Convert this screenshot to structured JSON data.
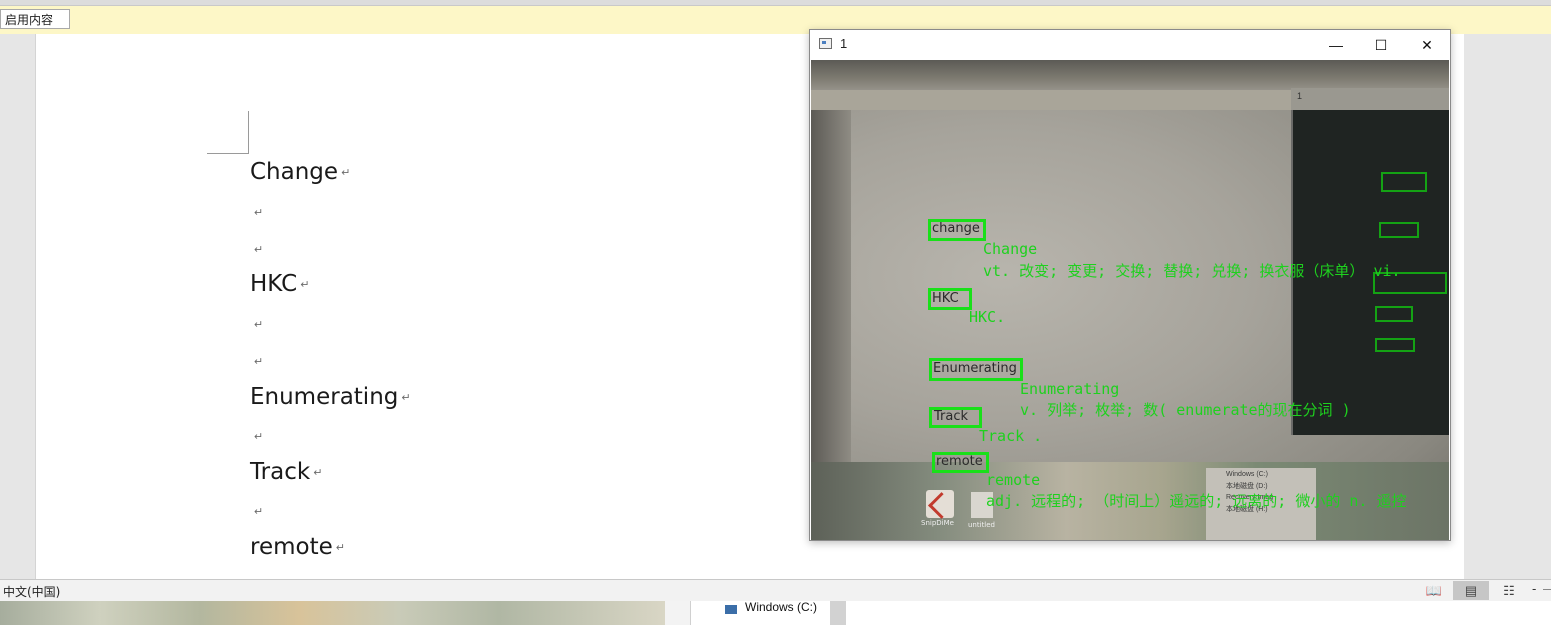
{
  "message_bar": {
    "enable_button": "启用内容"
  },
  "document": {
    "paragraphs": [
      {
        "text": "Change"
      },
      {
        "text": "HKC"
      },
      {
        "text": "Enumerating"
      },
      {
        "text": "Track"
      },
      {
        "text": "remote"
      }
    ],
    "paragraph_mark": "↵"
  },
  "status_bar": {
    "language": "中文(中国)",
    "zoom_minus": "-"
  },
  "bottom_strip": {
    "drive_label": "Windows (C:)"
  },
  "camera_window": {
    "title": "1",
    "controls": {
      "minimize": "—",
      "maximize": "☐",
      "close": "✕"
    },
    "detections": [
      {
        "word": "change",
        "translation": [
          "Change",
          "vt. 改变; 变更; 交换; 替换; 兑换; 换衣服（床单） vi."
        ]
      },
      {
        "word": "HKC",
        "translation": [
          "HKC."
        ]
      },
      {
        "word": "Enumerating",
        "translation": [
          "Enumerating",
          "v. 列举; 枚举; 数( enumerate的现在分词 )"
        ]
      },
      {
        "word": "Track",
        "translation": [
          "Track ."
        ]
      },
      {
        "word": "remote",
        "translation": [
          "remote",
          "adj. 远程的; （时间上）遥远的; 远离的; 微小的 n. 遥控"
        ]
      }
    ],
    "inner_window_title": "1",
    "explorer_items": [
      "Windows (C:)",
      "本地磁盘 (D:)",
      "Recovery Imag",
      "本地磁盘 (H:)"
    ],
    "app_labels": [
      "SnipDiMe",
      "untitled"
    ],
    "box_color": "#19e019",
    "text_color": "#1ed11e"
  }
}
